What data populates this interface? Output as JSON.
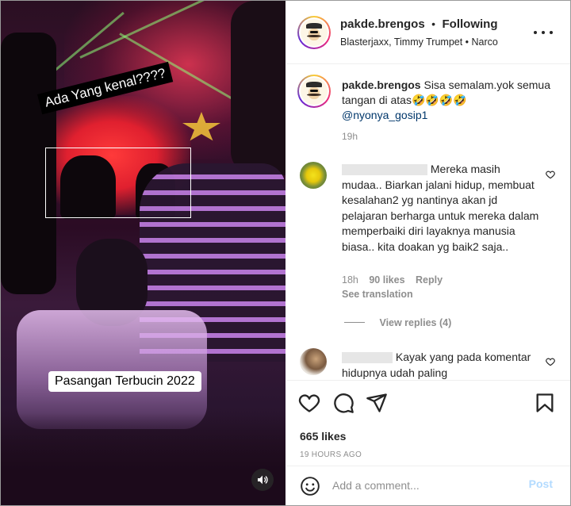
{
  "media": {
    "overlay_question": "Ada Yang kenal????",
    "overlay_caption": "Pasangan Terbucin 2022",
    "audio_icon": "speaker-icon"
  },
  "header": {
    "username": "pakde.brengos",
    "separator": "•",
    "follow_status": "Following",
    "music": "Blasterjaxx, Timmy Trumpet • Narco",
    "more_icon": "more-horizontal-icon"
  },
  "caption": {
    "username": "pakde.brengos",
    "text": "Sisa semalam.yok semua tangan di atas🤣🤣🤣🤣",
    "mention": "@nyonya_gosip1",
    "time": "19h"
  },
  "comments": [
    {
      "text": "Mereka masih mudaa.. Biarkan jalani hidup, membuat kesalahan2 yg nantinya akan jd pelajaran berharga untuk mereka dalam memperbaiki diri layaknya manusia biasa.. kita doakan yg baik2 saja..",
      "time": "18h",
      "likes": "90 likes",
      "reply": "Reply",
      "see_translation": "See translation",
      "view_replies": "View replies (4)"
    },
    {
      "text": "Kayak yang pada komentar hidupnya udah paling"
    }
  ],
  "actions": {
    "like_icon": "heart-icon",
    "comment_icon": "comment-icon",
    "share_icon": "send-icon",
    "save_icon": "bookmark-icon",
    "likes": "665 likes",
    "time_ago": "19 HOURS AGO"
  },
  "add_comment": {
    "emoji_icon": "emoji-icon",
    "placeholder": "Add a comment...",
    "post_label": "Post"
  },
  "colors": {
    "link": "#00376b",
    "muted": "#8e8e8e",
    "post_disabled": "#b3dbff"
  }
}
